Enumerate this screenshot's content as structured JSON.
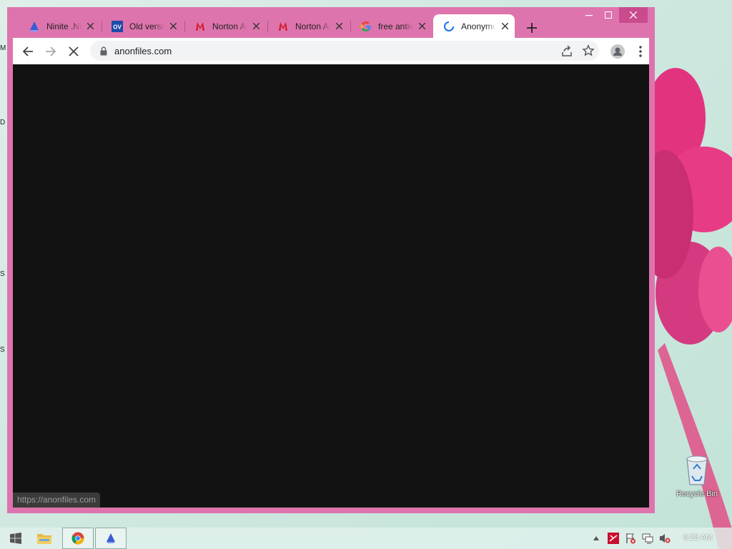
{
  "colors": {
    "window_frame": "#de74ad",
    "toolbar": "#ffffff",
    "viewport": "#121212",
    "omnibox": "#f1f3f4"
  },
  "tabs": [
    {
      "title": "Ninite .NE",
      "favicon": "ninite-icon",
      "active": false
    },
    {
      "title": "Old versio",
      "favicon": "oldversion-icon",
      "favicon_text": "OV",
      "active": false
    },
    {
      "title": "Norton An",
      "favicon": "norton-m-icon",
      "active": false
    },
    {
      "title": "Norton An",
      "favicon": "norton-m-icon",
      "active": false
    },
    {
      "title": "free antivi",
      "favicon": "google-icon",
      "active": false
    },
    {
      "title": "Anonymo",
      "favicon": "loading-spinner-icon",
      "active": true
    }
  ],
  "toolbar": {
    "url": "anonfiles.com"
  },
  "status_bar": {
    "text": "https://anonfiles.com"
  },
  "desktop": {
    "recycle_bin_label": "Recycle Bin",
    "edge_letters": [
      "M",
      "D",
      "S",
      "S"
    ]
  },
  "taskbar": {
    "clock": "9:23 AM"
  }
}
